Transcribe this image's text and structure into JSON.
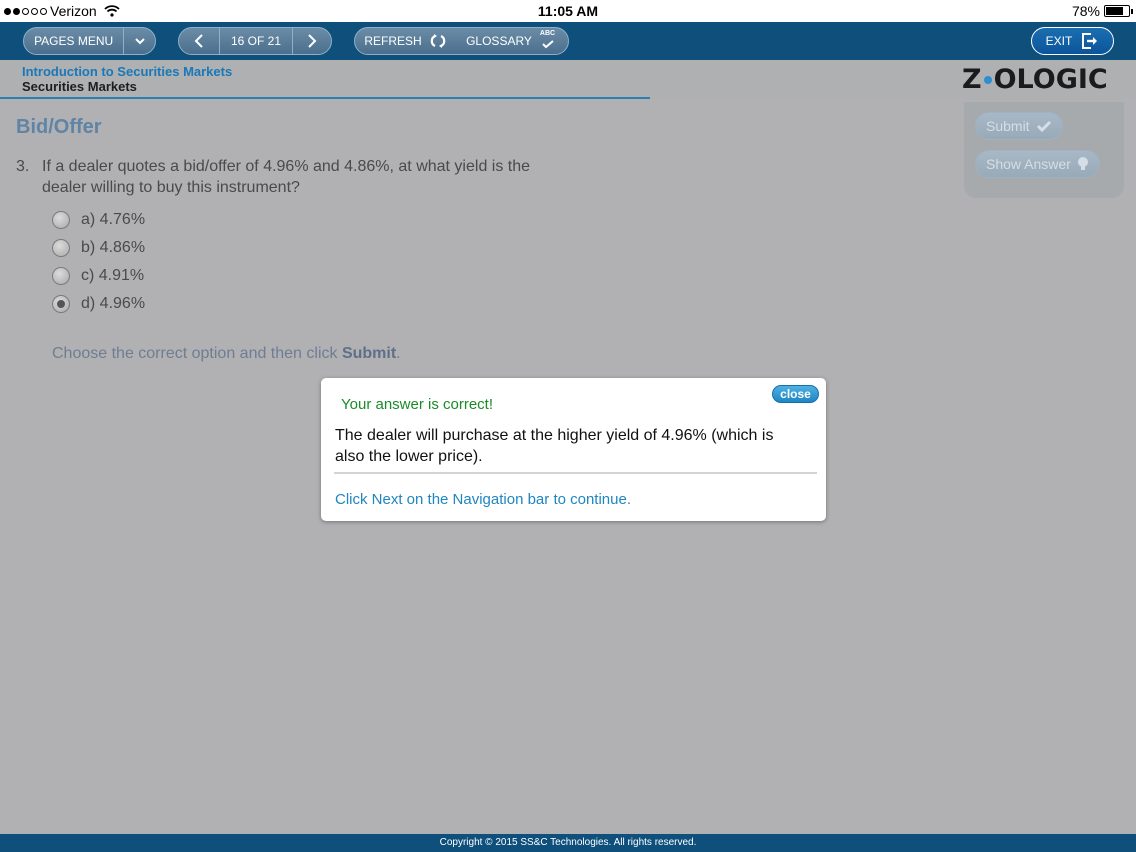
{
  "status_bar": {
    "carrier": "Verizon",
    "time": "11:05 AM",
    "battery": "78%",
    "battery_level": 0.78,
    "signal_bars_filled": 2,
    "signal_bars_total": 5
  },
  "navbar": {
    "pages_menu_label": "PAGES MENU",
    "page_indicator": "16 OF 21",
    "refresh_label": "REFRESH",
    "glossary_label": "GLOSSARY",
    "glossary_icon_text": "ABC",
    "exit_label": "EXIT"
  },
  "header": {
    "course_title": "Introduction to Securities Markets",
    "course_subtitle": "Securities Markets",
    "logo_left": "Z",
    "logo_right": "OLOGIC"
  },
  "content": {
    "page_heading": "Bid/Offer",
    "question_number": "3.",
    "question_text": "If a dealer quotes a bid/offer of 4.96% and 4.86%, at what yield is the dealer willing to buy this instrument?",
    "options": [
      {
        "label": "a) 4.76%",
        "selected": false
      },
      {
        "label": "b) 4.86%",
        "selected": false
      },
      {
        "label": "c) 4.91%",
        "selected": false
      },
      {
        "label": "d) 4.96%",
        "selected": true
      }
    ],
    "instruction_prefix": "Choose the correct option and then click ",
    "instruction_bold": "Submit",
    "instruction_suffix": "."
  },
  "actions": {
    "submit_label": "Submit",
    "show_answer_label": "Show Answer"
  },
  "popup": {
    "close_label": "close",
    "status": "Your answer is correct!",
    "explanation": "The dealer will purchase at the higher yield of 4.96% (which is also the lower price).",
    "next_hint": "Click Next on the Navigation bar to continue."
  },
  "footer": {
    "copyright": "Copyright © 2015 SS&C Technologies. All rights reserved."
  },
  "colors": {
    "nav_bg": "#0e4f7c",
    "accent_blue": "#1a78b8",
    "correct_green": "#1b8b2a",
    "overlay_gray": "#b1b1b3"
  }
}
